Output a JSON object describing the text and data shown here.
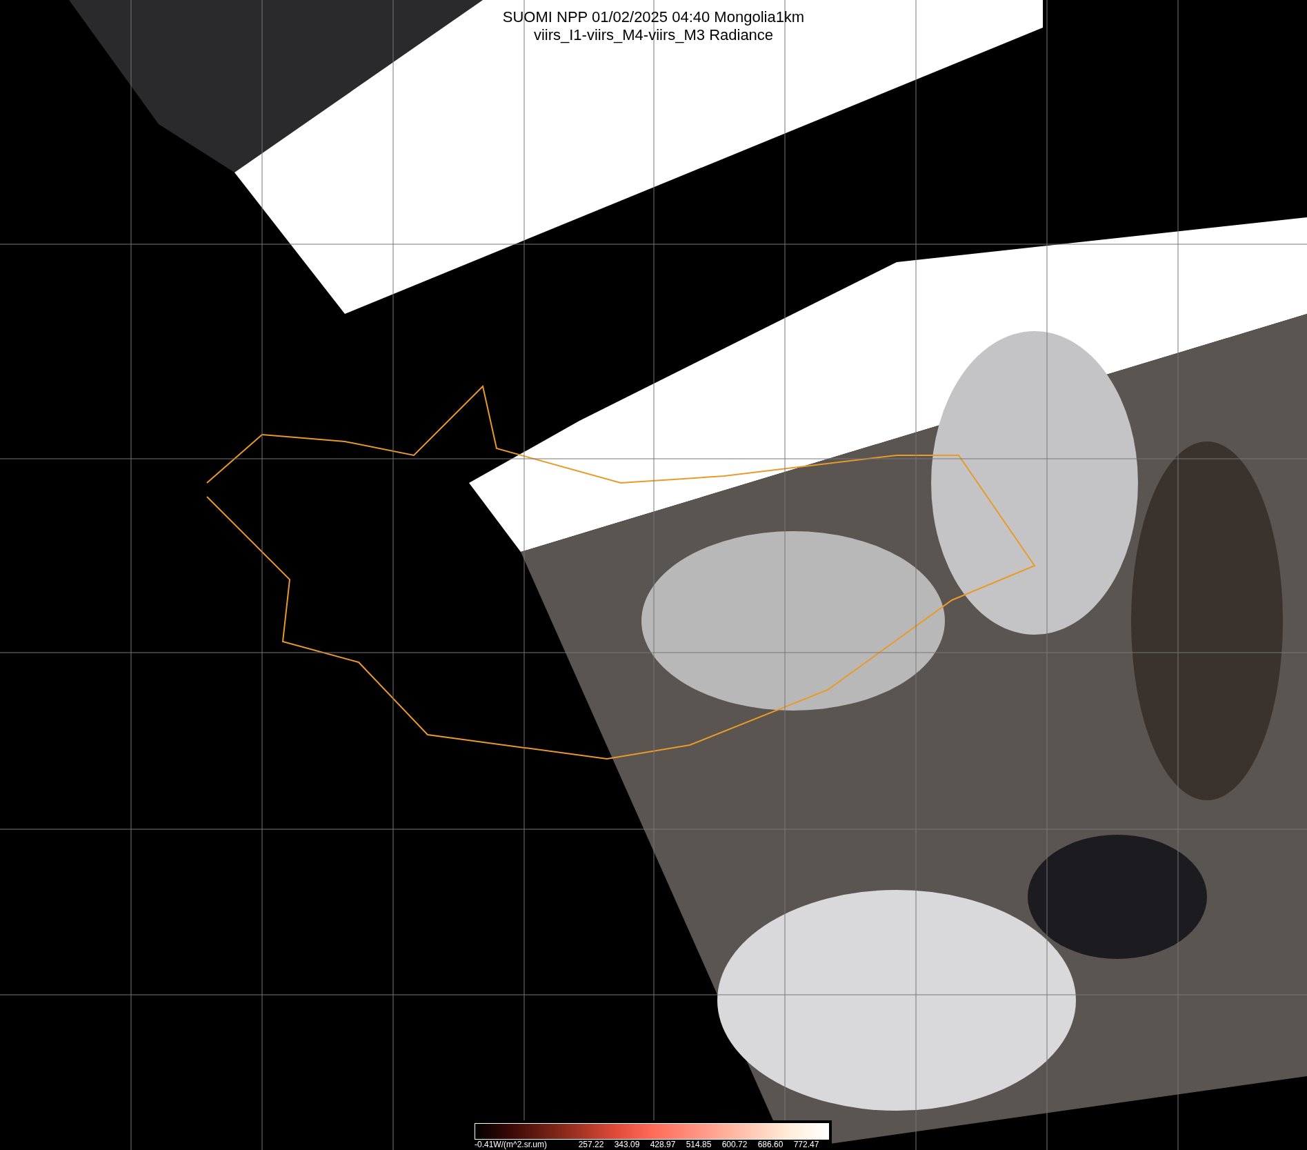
{
  "title": {
    "line1": "SUOMI NPP 01/02/2025 04:40 Mongolia1km",
    "line2": "viirs_I1-viirs_M4-viirs_M3 Radiance"
  },
  "colorbar": {
    "labels": [
      "-0.41W/(m^2.sr.um)",
      "257.22",
      "343.09",
      "428.97",
      "514.85",
      "600.72",
      "686.60",
      "772.47"
    ]
  }
}
